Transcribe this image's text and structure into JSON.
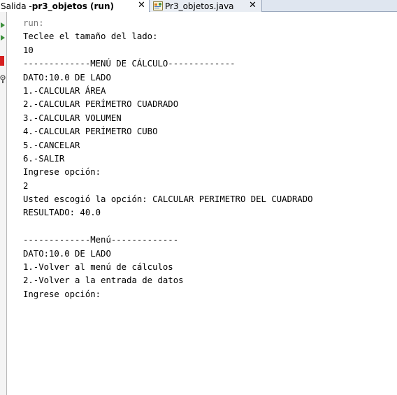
{
  "tabs": [
    {
      "prefix": "Salida - ",
      "title": "pr3_objetos (run)",
      "close": "✕",
      "active": true
    },
    {
      "prefix": "",
      "title": "Pr3_objetos.java",
      "close": "✕",
      "active": false,
      "icon": "java-file-icon"
    }
  ],
  "output": {
    "lines": [
      "run:",
      "Teclee el tamaño del lado:",
      "10",
      "-------------MENÚ DE CÁLCULO-------------",
      "DATO:10.0 DE LADO",
      "1.-CALCULAR ÁREA",
      "2.-CALCULAR PERÍMETRO CUADRADO",
      "3.-CALCULAR VOLUMEN",
      "4.-CALCULAR PERÍMETRO CUBO",
      "5.-CANCELAR",
      "6.-SALIR",
      "Ingrese opción:",
      "2",
      "Usted escogió la opción: CALCULAR PERIMETRO DEL CUADRADO",
      "RESULTADO: 40.0",
      "",
      "-------------Menú-------------",
      "DATO:10.0 DE LADO",
      "1.-Volver al menú de cálculos",
      "2.-Volver a la entrada de datos",
      "Ingrese opción:"
    ]
  },
  "gutter": {
    "buttons": [
      "run-again-icon",
      "stop-icon",
      "output-settings-icon"
    ]
  },
  "colors": {
    "run_text": "#7a7a7a",
    "tabbar_bg": "#dfe6f0",
    "stop_red": "#d62020"
  }
}
